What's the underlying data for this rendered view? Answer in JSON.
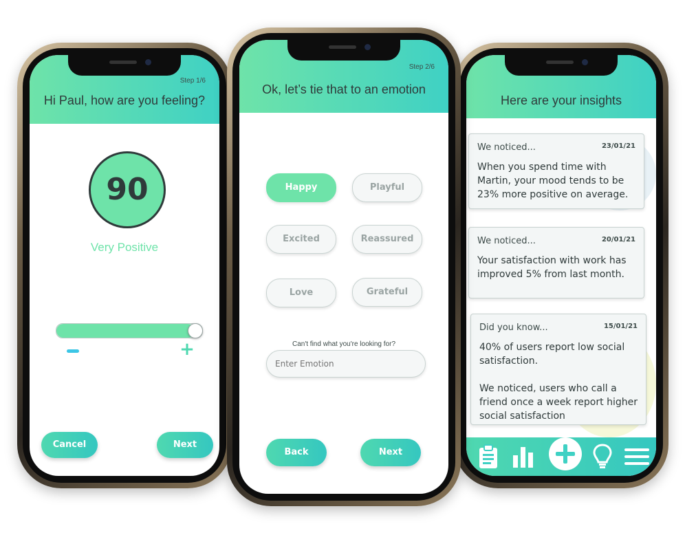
{
  "colors": {
    "accent_green": "#6ee3a9",
    "accent_teal": "#3fd1c4",
    "minus_blue": "#3cc6e6",
    "text_dark": "#2f3a3a"
  },
  "screen1": {
    "step": "Step 1/6",
    "title": "Hi Paul, how are you feeling?",
    "score": "90",
    "mood_label": "Very Positive",
    "slider_level_percent": 95,
    "minus_symbol": "−",
    "plus_symbol": "+",
    "cancel_label": "Cancel",
    "next_label": "Next"
  },
  "screen2": {
    "step": "Step 2/6",
    "title": "Ok, let’s tie that to an emotion",
    "emotions": [
      "Happy",
      "Playful",
      "Excited",
      "Reassured",
      "Love",
      "Grateful"
    ],
    "selected_emotion": "Happy",
    "cant_find_text": "Can't find what you're looking for?",
    "input_placeholder": "Enter Emotion",
    "back_label": "Back",
    "next_label": "Next"
  },
  "screen3": {
    "title": "Here are your insights",
    "cards": [
      {
        "label": "We noticed...",
        "date": "23/01/21",
        "text": "When you spend time with Martin, your mood tends to be 23% more positive on average."
      },
      {
        "label": "We noticed...",
        "date": "20/01/21",
        "text": "Your satisfaction with work has improved 5% from last month."
      },
      {
        "label": "Did you know...",
        "date": "15/01/21",
        "text": "40% of users report low social satisfaction.",
        "text2": "We noticed, users who call a friend once a week report higher social satisfaction"
      }
    ],
    "nav_icons": [
      "clipboard-icon",
      "bar-chart-icon",
      "add-icon",
      "lightbulb-icon",
      "menu-icon"
    ]
  }
}
